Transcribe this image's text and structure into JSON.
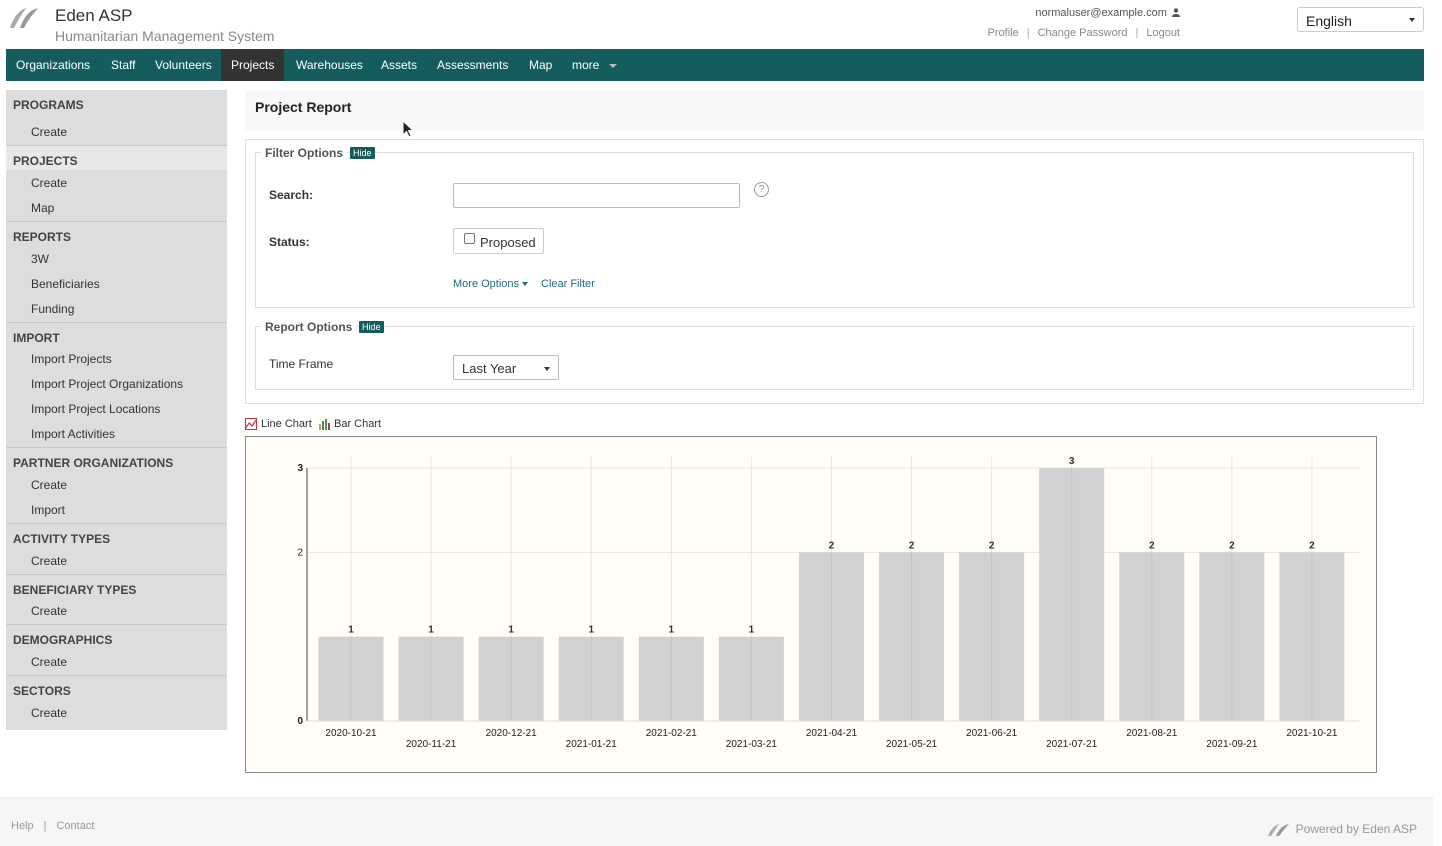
{
  "header": {
    "app_title": "Eden ASP",
    "app_subtitle": "Humanitarian Management System",
    "user_email": "normaluser@example.com",
    "links": [
      "Profile",
      "Change Password",
      "Logout"
    ],
    "language": "English"
  },
  "nav": {
    "items": [
      "Organizations",
      "Staff",
      "Volunteers",
      "Projects",
      "Warehouses",
      "Assets",
      "Assessments",
      "Map",
      "more"
    ],
    "active": "Projects"
  },
  "sidebar": {
    "sections": [
      {
        "title": "PROGRAMS",
        "items": [
          "Create"
        ]
      },
      {
        "title": "PROJECTS",
        "items": [
          "Create",
          "Map"
        ]
      },
      {
        "title": "REPORTS",
        "items": [
          "3W",
          "Beneficiaries",
          "Funding"
        ]
      },
      {
        "title": "IMPORT",
        "items": [
          "Import Projects",
          "Import Project Organizations",
          "Import Project Locations",
          "Import Activities"
        ]
      },
      {
        "title": "PARTNER ORGANIZATIONS",
        "items": [
          "Create",
          "Import"
        ]
      },
      {
        "title": "ACTIVITY TYPES",
        "items": [
          "Create"
        ]
      },
      {
        "title": "BENEFICIARY TYPES",
        "items": [
          "Create"
        ]
      },
      {
        "title": "DEMOGRAPHICS",
        "items": [
          "Create"
        ]
      },
      {
        "title": "SECTORS",
        "items": [
          "Create"
        ]
      }
    ]
  },
  "main": {
    "page_title": "Project Report",
    "filter": {
      "legend": "Filter Options",
      "hide_label": "Hide",
      "search_label": "Search:",
      "search_value": "",
      "help_glyph": "?",
      "status_label": "Status:",
      "status_option": "Proposed",
      "status_checked": false,
      "more_options": "More Options",
      "clear_filter": "Clear Filter"
    },
    "report": {
      "legend": "Report Options",
      "hide_label": "Hide",
      "time_frame_label": "Time Frame",
      "time_frame_value": "Last Year"
    },
    "chart_tabs": [
      "Line Chart",
      "Bar Chart"
    ]
  },
  "chart_data": {
    "type": "bar",
    "categories": [
      "2020-10-21",
      "2020-11-21",
      "2020-12-21",
      "2021-01-21",
      "2021-02-21",
      "2021-03-21",
      "2021-04-21",
      "2021-05-21",
      "2021-06-21",
      "2021-07-21",
      "2021-08-21",
      "2021-09-21",
      "2021-10-21"
    ],
    "values": [
      1,
      1,
      1,
      1,
      1,
      1,
      2,
      2,
      2,
      3,
      2,
      2,
      2
    ],
    "yticks": [
      0,
      2,
      3
    ],
    "ylim": [
      0,
      3
    ],
    "title": "",
    "xlabel": "",
    "ylabel": "",
    "bar_color": "#d1d1d1",
    "background": "#fffdf5"
  },
  "footer": {
    "links": [
      "Help",
      "Contact"
    ],
    "powered": "Powered by Eden ASP"
  },
  "colors": {
    "nav_bg": "#155d5d",
    "nav_active": "#333333",
    "sidebar_bg": "#dddddd"
  }
}
